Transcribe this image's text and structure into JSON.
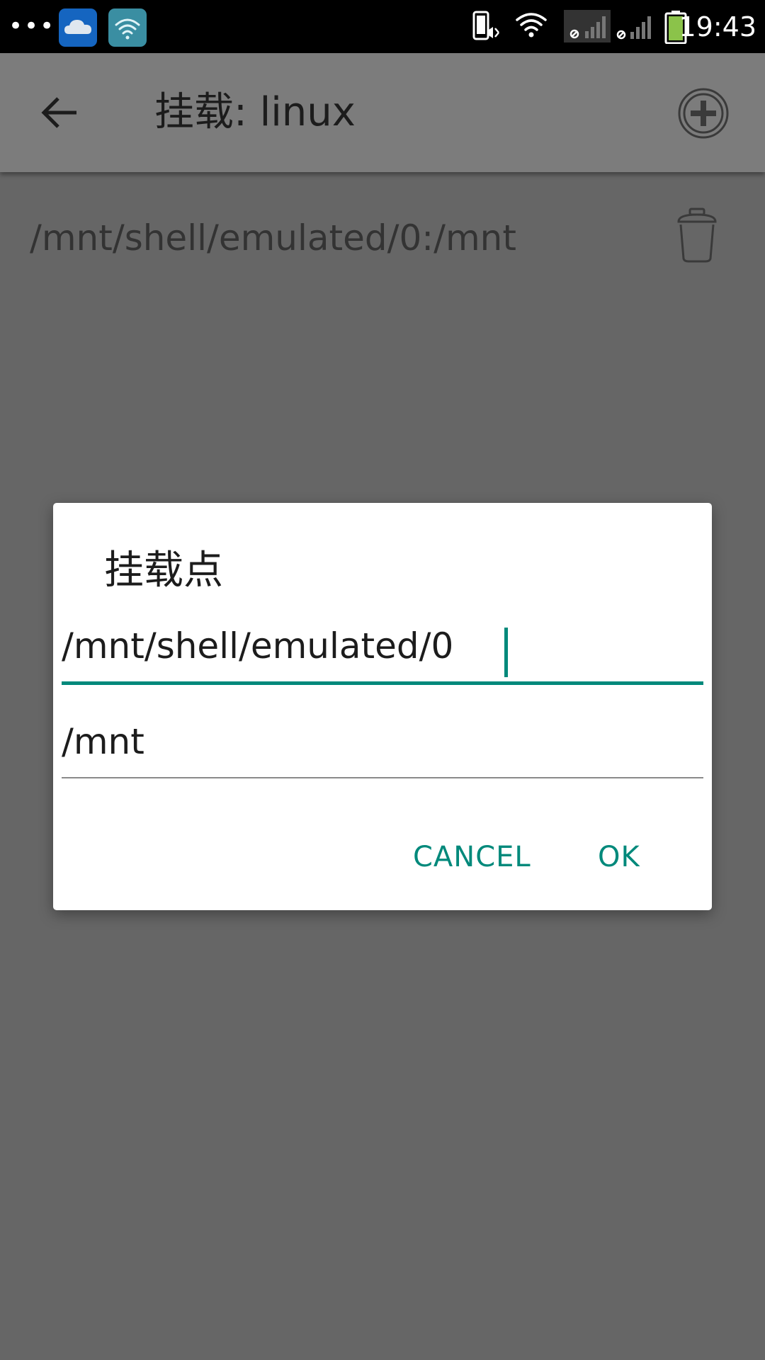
{
  "status_bar": {
    "time": "19:43",
    "icons": [
      "more-dots-icon",
      "cloud-app-icon",
      "wifi-app-icon",
      "vibrate-icon",
      "wifi-icon",
      "no-signal-icon",
      "no-signal-icon",
      "battery-icon"
    ]
  },
  "app_bar": {
    "title": "挂载: linux",
    "back_icon": "arrow-left-icon",
    "add_icon": "add-circle-icon"
  },
  "mounts": [
    {
      "label": "/mnt/shell/emulated/0:/mnt",
      "delete_icon": "trash-icon"
    }
  ],
  "dialog": {
    "title": "挂载点",
    "source_value": "/mnt/shell/emulated/0",
    "target_value": "/mnt",
    "cancel_label": "CANCEL",
    "ok_label": "OK"
  },
  "colors": {
    "accent": "#00897b",
    "scrim": "#666666",
    "status_bar": "#000000",
    "dialog_bg": "#ffffff"
  }
}
